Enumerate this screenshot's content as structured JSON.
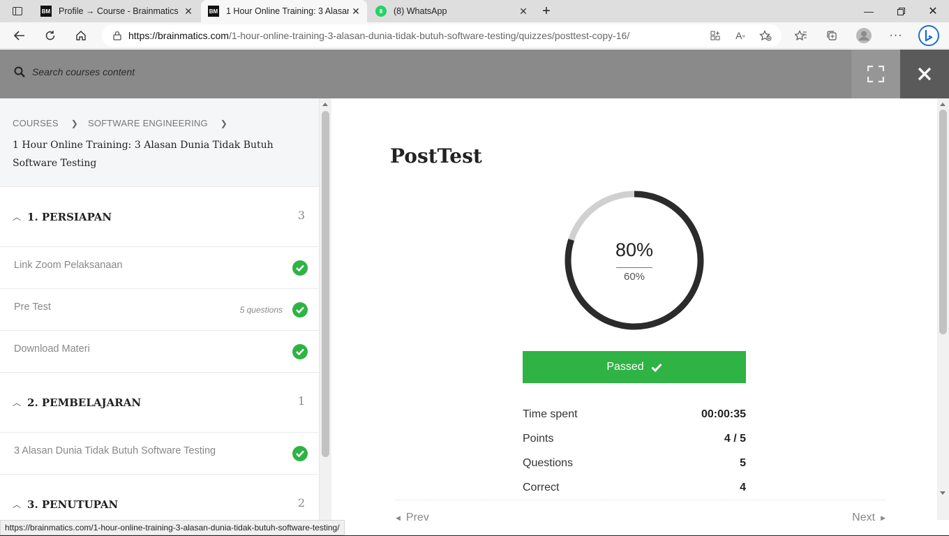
{
  "browser": {
    "tabs": [
      {
        "title": "Profile → Course - Brainmatics",
        "favicon": "BM"
      },
      {
        "title": "1 Hour Online Training: 3 Alasan",
        "favicon": "BM"
      },
      {
        "title": "(8) WhatsApp",
        "favicon": "8"
      }
    ],
    "url_host": "https://brainmatics.com",
    "url_path": "/1-hour-online-training-3-alasan-dunia-tidak-butuh-software-testing/quizzes/posttest-copy-16/",
    "status_url": "https://brainmatics.com/1-hour-online-training-3-alasan-dunia-tidak-butuh-software-testing/"
  },
  "topbar": {
    "search_placeholder": "Search courses content"
  },
  "sidebar": {
    "breadcrumb": [
      "COURSES",
      "SOFTWARE ENGINEERING"
    ],
    "course_title": "1 Hour Online Training: 3 Alasan Dunia Tidak Butuh Software Testing",
    "sections": [
      {
        "name": "1. PERSIAPAN",
        "count": "3",
        "lessons": [
          {
            "name": "Link Zoom Pelaksanaan",
            "meta": ""
          },
          {
            "name": "Pre Test",
            "meta": "5 questions"
          },
          {
            "name": "Download Materi",
            "meta": ""
          }
        ]
      },
      {
        "name": "2. PEMBELAJARAN",
        "count": "1",
        "lessons": [
          {
            "name": "3 Alasan Dunia Tidak Butuh Software Testing",
            "meta": ""
          }
        ]
      },
      {
        "name": "3. PENUTUPAN",
        "count": "2",
        "lessons": []
      }
    ]
  },
  "quiz": {
    "title": "PostTest",
    "result_percent": "80%",
    "result_fraction": 0.8,
    "passing_grade": "60%",
    "status_label": "Passed",
    "stats": [
      {
        "label": "Time spent",
        "value": "00:00:35"
      },
      {
        "label": "Points",
        "value": "4 / 5"
      },
      {
        "label": "Questions",
        "value": "5"
      },
      {
        "label": "Correct",
        "value": "4"
      }
    ],
    "prev_label": "Prev",
    "next_label": "Next"
  },
  "colors": {
    "success": "#2fb344",
    "ring_fill": "#2b2b2b",
    "ring_track": "#d0d0d0"
  }
}
